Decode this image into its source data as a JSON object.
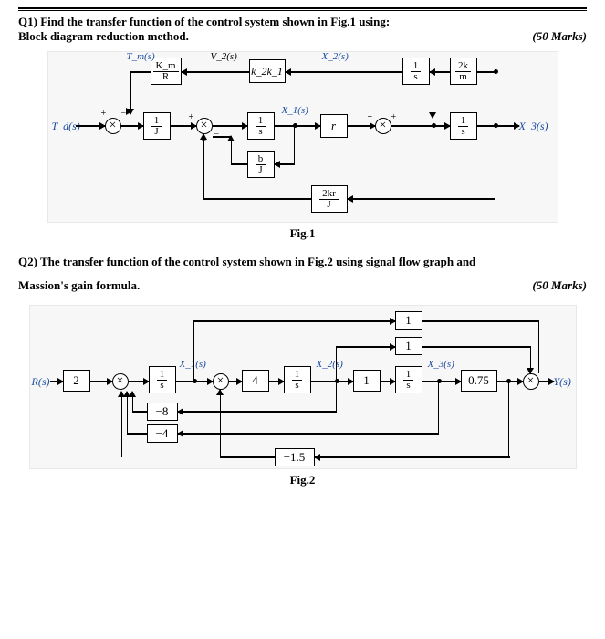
{
  "q1": {
    "line1": "Q1)  Find the transfer function of the control system shown in Fig.1 using:",
    "line2": "Block diagram reduction method.",
    "marks": "(50 Marks)",
    "caption": "Fig.1",
    "io": {
      "in": "T_d(s)",
      "out": "X_3(s)"
    },
    "signals": {
      "Tm": "T_m(s)",
      "V2": "V_2(s)",
      "X1": "X_1(s)",
      "X2": "X_2(s)"
    },
    "blocks": {
      "KmR": {
        "num": "K_m",
        "den": "R"
      },
      "k2k1": "k_2k_1",
      "oneJ1": {
        "num": "1",
        "den": "J"
      },
      "oneS1": {
        "num": "1",
        "den": "s"
      },
      "oneS2": {
        "num": "1",
        "den": "s"
      },
      "oneS3": {
        "num": "1",
        "den": "s"
      },
      "bJ": {
        "num": "b",
        "den": "J"
      },
      "r": "r",
      "twokrJ": {
        "num": "2kr",
        "den": "J"
      },
      "twokm": {
        "num": "2k",
        "den": "m"
      }
    }
  },
  "q2": {
    "text1": "Q2) The transfer function of the control system shown in Fig.2 using signal flow graph and",
    "text2": "Massion's gain formula.",
    "marks": "(50 Marks)",
    "caption": "Fig.2",
    "io": {
      "in": "R(s)",
      "out": "Y(s)"
    },
    "signals": {
      "X1": "X_1(s)",
      "X2": "X_2(s)",
      "X3": "X_3(s)"
    },
    "blocks": {
      "two": "2",
      "oneS1": {
        "num": "1",
        "den": "s"
      },
      "four": "4",
      "oneS2": {
        "num": "1",
        "den": "s"
      },
      "one": "1",
      "oneS3": {
        "num": "1",
        "den": "s"
      },
      "p075": "0.75",
      "fb_m8": "−8",
      "fb_m4": "−4",
      "fb_m15": "−1.5",
      "ff_top1": "1",
      "ff_top2": "1"
    }
  }
}
